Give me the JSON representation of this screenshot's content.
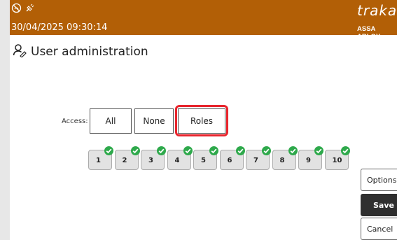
{
  "header": {
    "datetime": "30/04/2025 09:30:14",
    "status_icons": [
      "no-signal-icon",
      "unplugged-icon"
    ],
    "brand": {
      "name": "traka",
      "sub": "ASSA ABLOY"
    },
    "background_color": "#b25f06"
  },
  "page": {
    "title": "User administration",
    "icon": "user-edit-icon"
  },
  "access": {
    "label": "Access:",
    "options": [
      {
        "label": "All"
      },
      {
        "label": "None"
      },
      {
        "label": "Roles"
      }
    ],
    "selected": "Roles",
    "highlight_color": "#e8252d"
  },
  "roles": [
    {
      "label": "1",
      "checked": true
    },
    {
      "label": "2",
      "checked": true
    },
    {
      "label": "3",
      "checked": true
    },
    {
      "label": "4",
      "checked": true
    },
    {
      "label": "5",
      "checked": true
    },
    {
      "label": "6",
      "checked": true
    },
    {
      "label": "7",
      "checked": true
    },
    {
      "label": "8",
      "checked": true
    },
    {
      "label": "9",
      "checked": true
    },
    {
      "label": "10",
      "checked": true
    }
  ],
  "side_buttons": {
    "options": "Options",
    "save": "Save",
    "cancel": "Cancel"
  }
}
